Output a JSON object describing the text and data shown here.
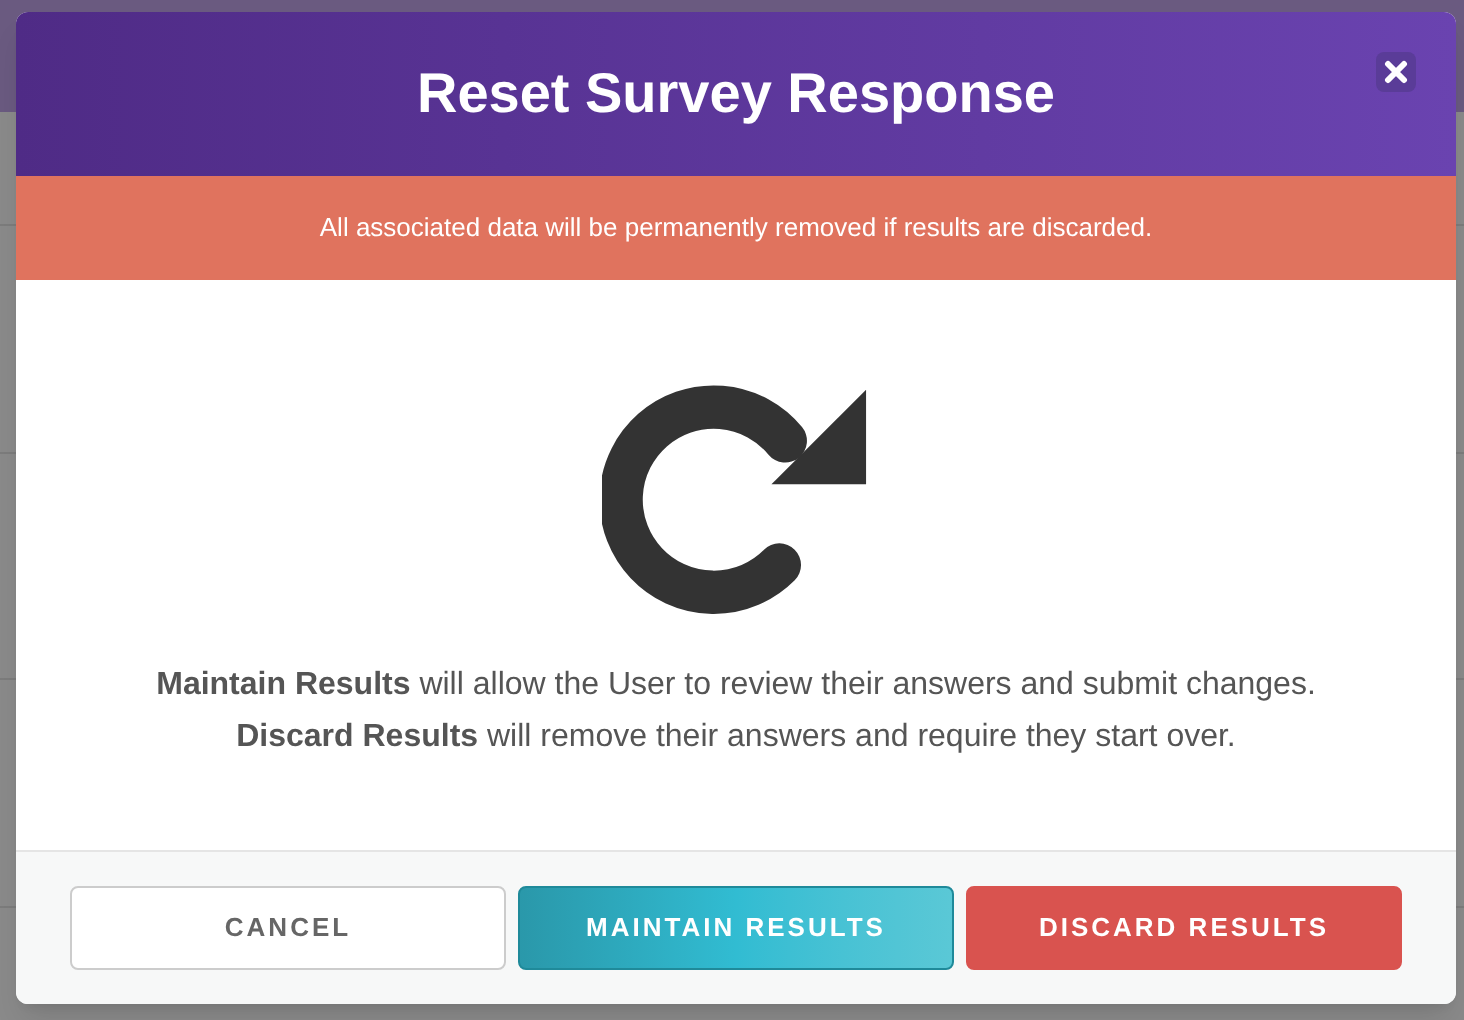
{
  "dialog": {
    "title": "Reset Survey Response",
    "warning": "All associated data will be permanently removed if results are discarded.",
    "description": [
      "**Maintain Results** will allow the User to review their answers and submit changes.",
      "**Discard Results** will remove their answers and require they start over."
    ],
    "buttons": [
      {
        "label": "CANCEL",
        "kind": "default"
      },
      {
        "label": "MAINTAIN RESULTS",
        "kind": "primary"
      },
      {
        "label": "DISCARD RESULTS",
        "kind": "danger"
      }
    ]
  }
}
